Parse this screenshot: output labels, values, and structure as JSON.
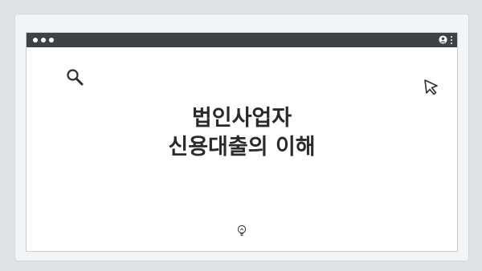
{
  "page": {
    "title_line1": "법인사업자",
    "title_line2": "신용대출의 이해"
  },
  "icons": {
    "window_controls": "traffic-light-dots",
    "profile": "user-icon",
    "menu": "kebab-menu-icon",
    "search": "search-icon",
    "pointer": "cursor-icon",
    "idea": "lightbulb-icon"
  },
  "colors": {
    "background": "#dfe3e5",
    "titlebar": "#3f4244",
    "window": "#ffffff",
    "text": "#2a2a2a"
  }
}
